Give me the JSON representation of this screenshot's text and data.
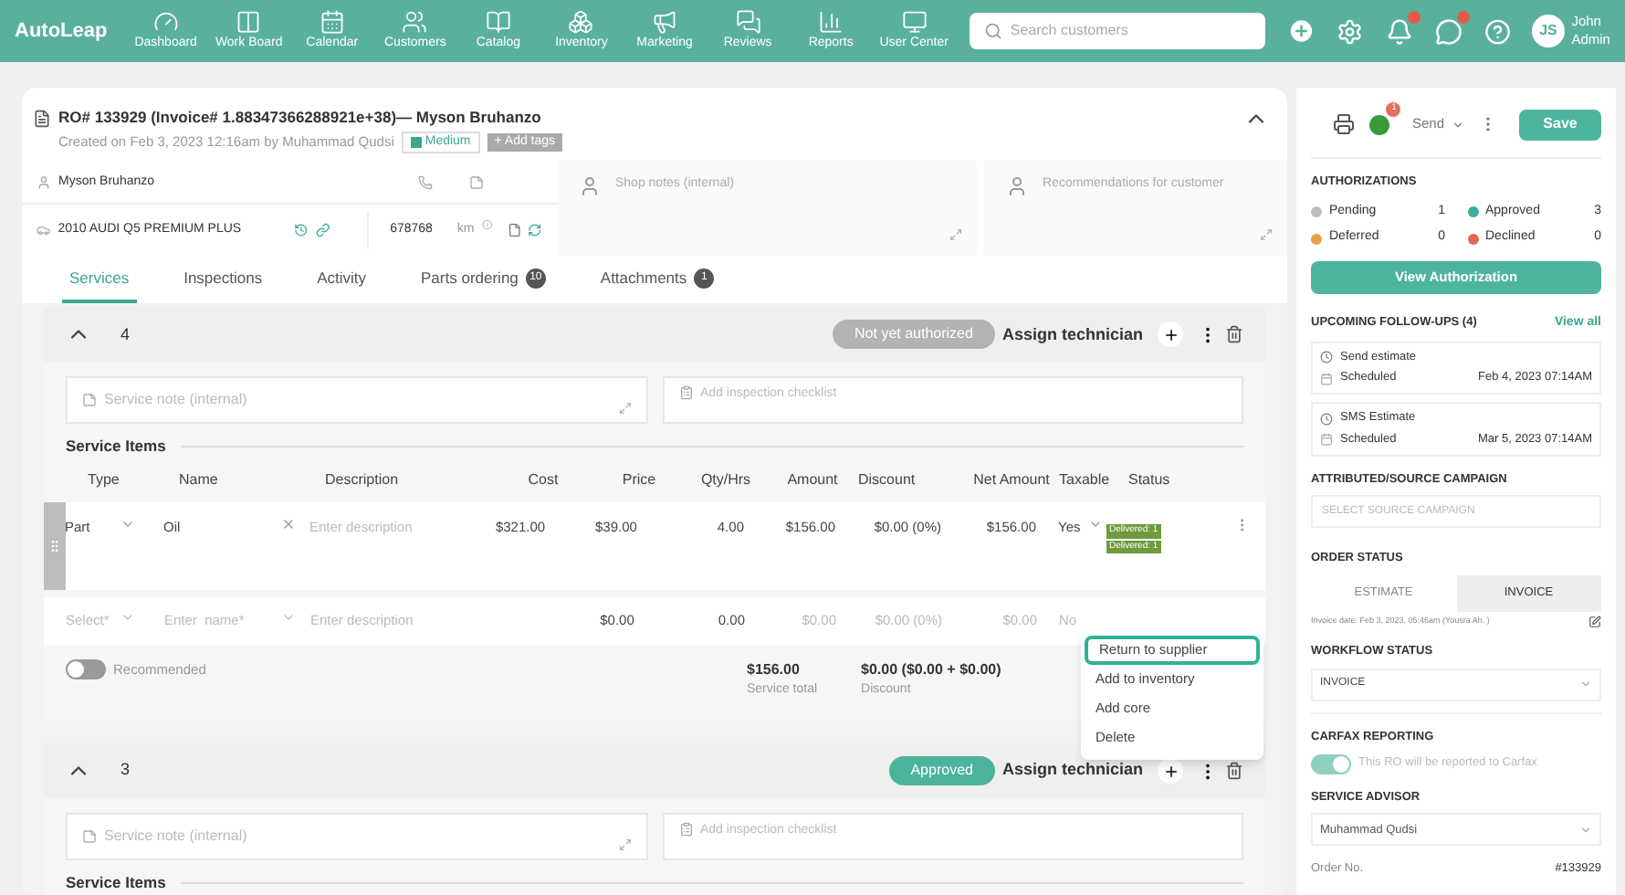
{
  "nav": {
    "logo": "AutoLeap",
    "items": [
      {
        "label": "Dashboard"
      },
      {
        "label": "Work Board"
      },
      {
        "label": "Calendar"
      },
      {
        "label": "Customers"
      },
      {
        "label": "Catalog"
      },
      {
        "label": "Inventory"
      },
      {
        "label": "Marketing"
      },
      {
        "label": "Reviews"
      },
      {
        "label": "Reports"
      },
      {
        "label": "User Center"
      }
    ],
    "search_placeholder": "Search customers",
    "user": {
      "initials": "JS",
      "name": "John",
      "role": "Admin"
    }
  },
  "ro": {
    "title": "RO# 133929 (Invoice# 1.88347366288921e+38)— Myson Bruhanzo",
    "created": "Created on Feb 3, 2023 12:16am by Muhammad Qudsi",
    "priority": "Medium",
    "add_tags": "+ Add tags",
    "customer": "Myson Bruhanzo",
    "vehicle": "2010 AUDI Q5 PREMIUM PLUS",
    "mileage": "678768",
    "unit": "km",
    "shop_notes_placeholder": "Shop notes (internal)",
    "recommendations_placeholder": "Recommendations for customer"
  },
  "tabs": [
    {
      "label": "Services",
      "selected": true
    },
    {
      "label": "Inspections",
      "selected": false
    },
    {
      "label": "Activity",
      "selected": false
    },
    {
      "label": "Parts ordering",
      "count": "10",
      "selected": false
    },
    {
      "label": "Attachments",
      "count": "1",
      "selected": false
    }
  ],
  "services": [
    {
      "number": "4",
      "status": "Not yet authorized",
      "kind": "pending",
      "assign": "Assign technician",
      "note_placeholder": "Service note (internal)",
      "checklist_placeholder": "Add inspection checklist",
      "items_title": "Service Items",
      "table": {
        "columns": [
          "Type",
          "Name",
          "Description",
          "Cost",
          "Price",
          "Qty/Hrs",
          "Amount",
          "Discount",
          "Net Amount",
          "Taxable",
          "Status"
        ],
        "rows": [
          {
            "type": "Part",
            "name": "Oil",
            "description_placeholder": "Enter description",
            "cost": "$321.00",
            "price": "$39.00",
            "qty": "4.00",
            "amount": "$156.00",
            "discount": "$0.00 (0%)",
            "net": "$156.00",
            "taxable": "Yes",
            "status_tags": [
              "Delivered: 1",
              "Delivered: 1"
            ]
          }
        ],
        "new_row": {
          "type_placeholder": "Select*",
          "name_placeholder": "Enter  name*",
          "description_placeholder": "Enter description",
          "price": "$0.00",
          "qty": "0.00",
          "amount": "$0.00",
          "discount": "$0.00 (0%)",
          "net": "$0.00",
          "taxable": "No"
        },
        "menu": [
          {
            "label": "Return to supplier",
            "selected": true
          },
          {
            "label": "Add to inventory",
            "selected": false
          },
          {
            "label": "Add core",
            "selected": false
          },
          {
            "label": "Delete",
            "selected": false
          }
        ],
        "recommended": {
          "label": "Recommended",
          "on": false
        },
        "totals": [
          {
            "value": "$156.00",
            "label": "Service total"
          },
          {
            "value": "$0.00 ($0.00 + $0.00)",
            "label": "Discount"
          }
        ]
      }
    },
    {
      "number": "3",
      "status": "Approved",
      "kind": "approved",
      "assign": "Assign technician",
      "note_placeholder": "Service note (internal)",
      "checklist_placeholder": "Add inspection checklist",
      "items_title": "Service Items"
    }
  ],
  "side": {
    "qb_badge": "1",
    "send": "Send",
    "save": "Save",
    "authorizations": {
      "title": "AUTHORIZATIONS",
      "items": [
        {
          "label": "Pending",
          "count": "1",
          "color": "#bdbdbd"
        },
        {
          "label": "Approved",
          "count": "3",
          "color": "#3fae98"
        },
        {
          "label": "Deferred",
          "count": "0",
          "color": "#e5a14a"
        },
        {
          "label": "Declined",
          "count": "0",
          "color": "#e0685a"
        }
      ],
      "button": "View Authorization"
    },
    "followups": {
      "title": "UPCOMING FOLLOW-UPS (4)",
      "view_all": "View all",
      "items": [
        {
          "title": "Send estimate",
          "status": "Scheduled",
          "date": "Feb 4, 2023 07:14AM"
        },
        {
          "title": "SMS Estimate",
          "status": "Scheduled",
          "date": "Mar 5, 2023 07:14AM"
        }
      ]
    },
    "campaign": {
      "title": "ATTRIBUTED/SOURCE CAMPAIGN",
      "placeholder": "SELECT SOURCE CAMPAIGN"
    },
    "order_status": {
      "title": "ORDER STATUS",
      "options": [
        {
          "label": "ESTIMATE",
          "selected": false
        },
        {
          "label": "INVOICE",
          "selected": true
        }
      ],
      "invoice_date": "Invoice date: Feb 3, 2023, 05:46am (Yousra Ah. )"
    },
    "workflow": {
      "title": "WORKFLOW STATUS",
      "value": "INVOICE"
    },
    "carfax": {
      "title": "CARFAX REPORTING",
      "on": true,
      "label": "This RO will be reported to Carfax"
    },
    "advisor": {
      "title": "SERVICE ADVISOR",
      "value": "Muhammad Qudsi"
    },
    "order_no": {
      "label": "Order No.",
      "value": "#133929"
    }
  }
}
